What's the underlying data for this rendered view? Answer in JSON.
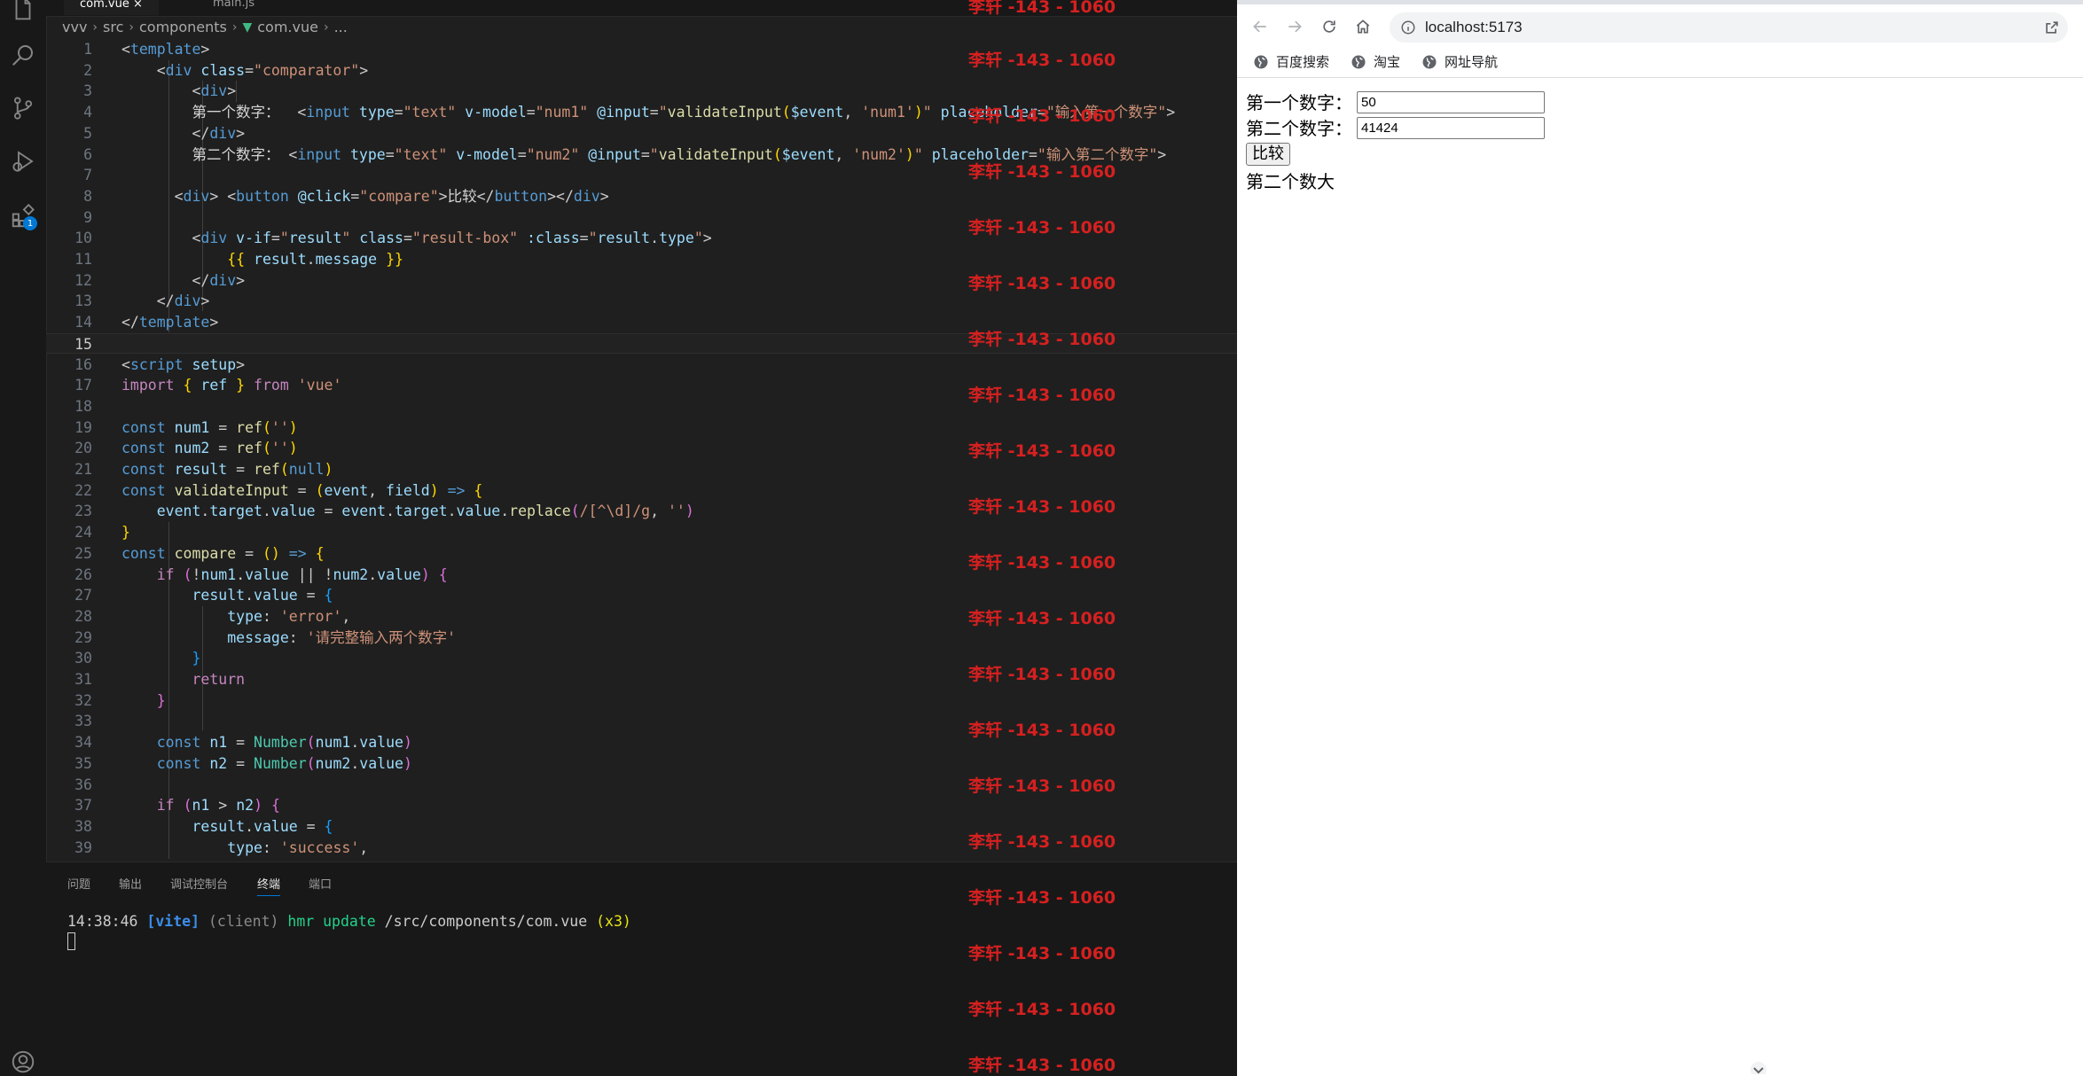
{
  "vscode": {
    "tabs": [
      "com.vue",
      "main.js"
    ],
    "breadcrumb": [
      "vvv",
      "src",
      "components",
      "com.vue",
      "..."
    ],
    "current_line": 15,
    "panel_tabs": [
      "问题",
      "输出",
      "调试控制台",
      "终端",
      "端口"
    ],
    "active_panel_tab": "终端",
    "terminal": {
      "time": "14:38:46",
      "tag": "[vite]",
      "client": "(client)",
      "action": "hmr update",
      "path": "/src/components/com.vue",
      "count": "(x3)"
    },
    "extensions_badge": "1"
  },
  "watermark": {
    "text": "李轩 -143 - 1060",
    "color": "#d62020"
  },
  "browser": {
    "url": "localhost:5173",
    "bookmarks": [
      "百度搜索",
      "淘宝",
      "网址导航"
    ]
  },
  "app": {
    "label1": "第一个数字：",
    "value1": "50",
    "label2": "第二个数字：",
    "value2": "41424",
    "button": "比较",
    "result": "第二个数大"
  },
  "colors": {
    "editor_bg": "#1f1f1f",
    "accent": "#0078d4",
    "watermark": "#d62020"
  }
}
